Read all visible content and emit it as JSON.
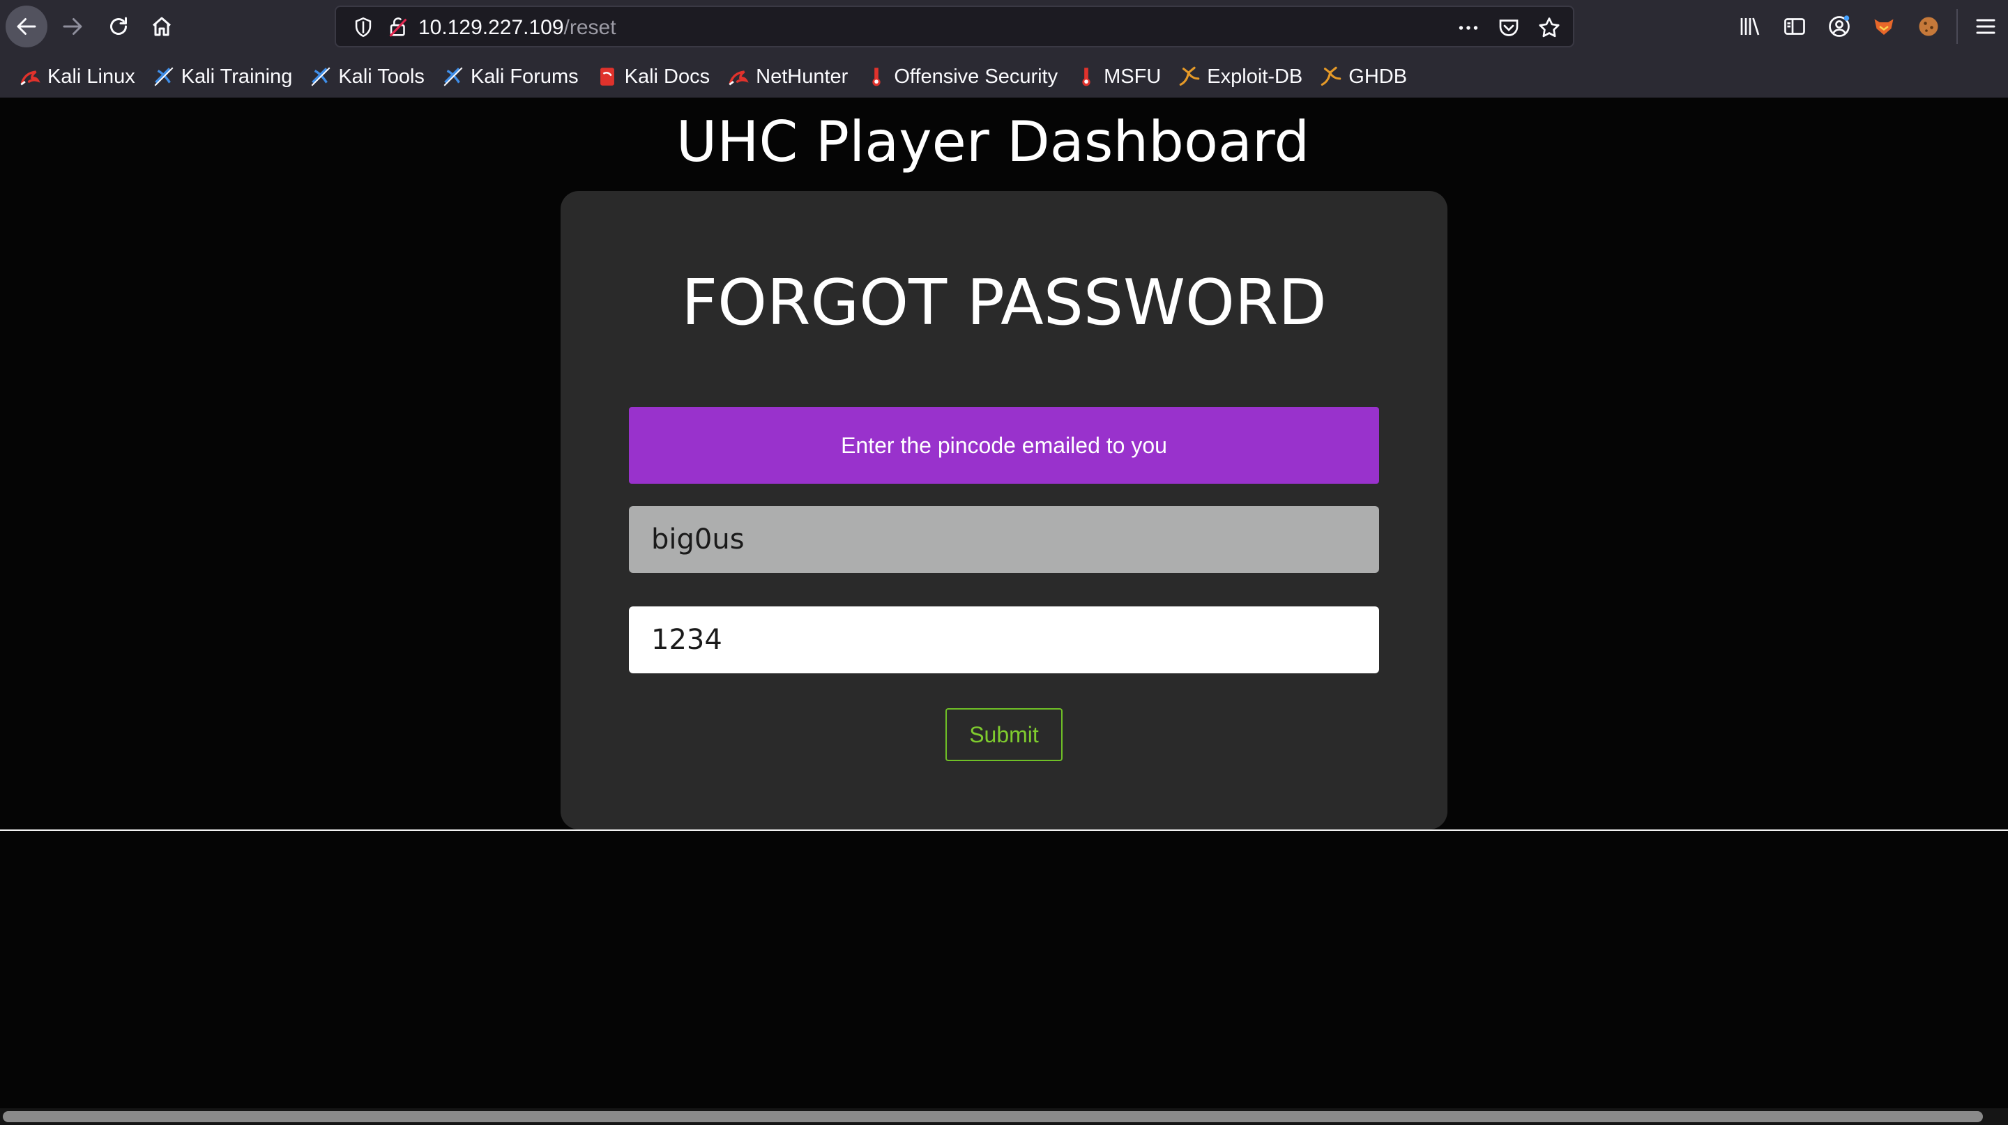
{
  "browser": {
    "url_host": "10.129.227.109",
    "url_path": "/reset",
    "icons": {
      "back": "arrow-left-icon",
      "forward": "arrow-right-icon",
      "reload": "reload-icon",
      "home": "home-icon",
      "tracking": "shield-icon",
      "insecure": "broken-lock-icon",
      "page_actions": "ellipsis-icon",
      "pocket": "pocket-icon",
      "bookmark": "star-icon",
      "library": "library-icon",
      "sidebar": "sidebar-icon",
      "account": "account-icon",
      "extension_1": "foxyproxy-icon",
      "extension_2": "cookie-icon",
      "menu": "hamburger-menu-icon"
    },
    "bookmarks": [
      {
        "label": "Kali Linux",
        "icon": "kali-dragon-icon",
        "color": "#e0322c"
      },
      {
        "label": "Kali Training",
        "icon": "kali-training-icon",
        "color": "#3f8ee8"
      },
      {
        "label": "Kali Tools",
        "icon": "kali-tools-icon",
        "color": "#3f8ee8"
      },
      {
        "label": "Kali Forums",
        "icon": "kali-forums-icon",
        "color": "#3f8ee8"
      },
      {
        "label": "Kali Docs",
        "icon": "kali-docs-icon",
        "color": "#e0322c"
      },
      {
        "label": "NetHunter",
        "icon": "kali-dragon-icon",
        "color": "#e0322c"
      },
      {
        "label": "Offensive Security",
        "icon": "offsec-icon",
        "color": "#e0322c"
      },
      {
        "label": "MSFU",
        "icon": "offsec-icon",
        "color": "#e0322c"
      },
      {
        "label": "Exploit-DB",
        "icon": "exploit-db-icon",
        "color": "#e69a28"
      },
      {
        "label": "GHDB",
        "icon": "exploit-db-icon",
        "color": "#e69a28"
      }
    ]
  },
  "page": {
    "title": "UHC Player Dashboard",
    "form": {
      "heading": "FORGOT PASSWORD",
      "notice": "Enter the pincode emailed to you",
      "username_value": "big0us",
      "pincode_value": "1234",
      "submit_label": "Submit"
    }
  },
  "colors": {
    "notice_bg": "#9932cc",
    "submit_accent": "#7fcc2e",
    "card_bg": "#2a2a2a",
    "page_bg": "#050505"
  }
}
